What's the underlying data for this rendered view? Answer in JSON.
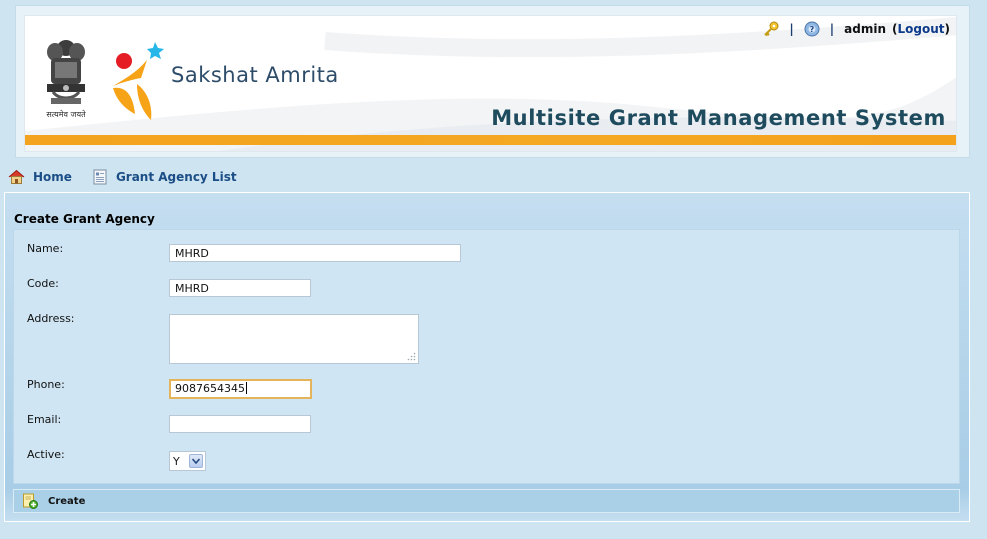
{
  "header": {
    "logo_text": "Sakshat Amrita",
    "system_title": "Multisite Grant Management System",
    "emblem_caption": "सत्यमेव जयते",
    "username": "admin",
    "logout_open": "(",
    "logout_label": "Logout",
    "logout_close": ")",
    "separator": "|",
    "icons": [
      "key-icon",
      "help-icon"
    ]
  },
  "nav": {
    "home_label": "Home",
    "list_label": "Grant Agency List"
  },
  "form": {
    "title": "Create Grant Agency",
    "name_label": "Name:",
    "name_value": "MHRD",
    "code_label": "Code:",
    "code_value": "MHRD",
    "address_label": "Address:",
    "address_value": "",
    "phone_label": "Phone:",
    "phone_value": "9087654345",
    "email_label": "Email:",
    "email_value": "",
    "active_label": "Active:",
    "active_value": "Y",
    "create_label": "Create"
  },
  "colors": {
    "accent_orange": "#f3a31d",
    "title_teal": "#1f4b5e",
    "link_blue": "#1b4e86",
    "panel_blue": "#a8cde6"
  }
}
